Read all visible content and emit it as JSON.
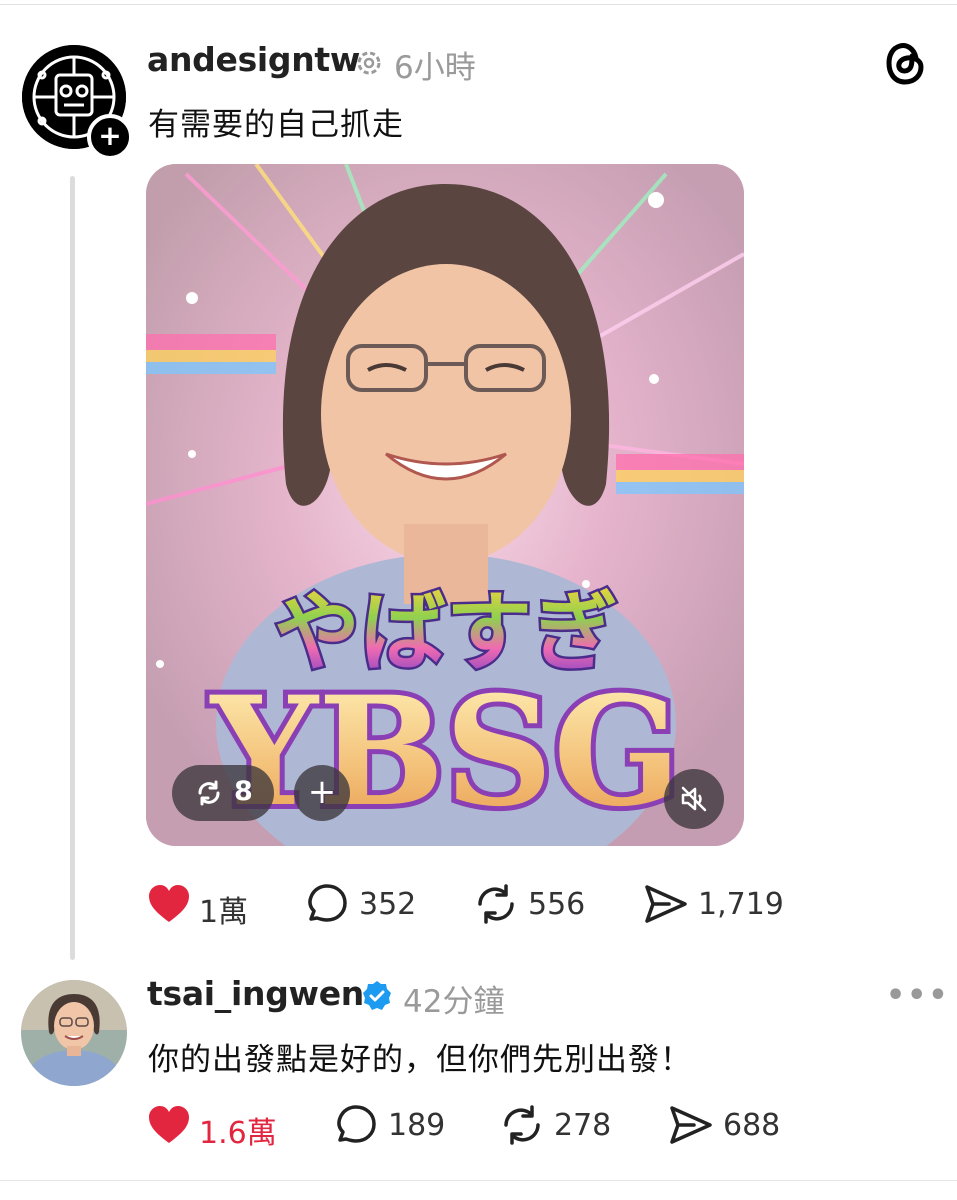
{
  "post": {
    "username": "andesigntw",
    "time": "6小時",
    "text": "有需要的自己抓走",
    "media": {
      "jp_text": "やばすぎ",
      "big_text": "YBSG",
      "repost_count": "8"
    },
    "actions": {
      "likes": "1萬",
      "replies": "352",
      "reposts": "556",
      "shares": "1,719"
    }
  },
  "reply": {
    "username": "tsai_ingwen",
    "time": "42分鐘",
    "text": "你的出發點是好的，但你們先別出發！",
    "actions": {
      "likes": "1.6萬",
      "replies": "189",
      "reposts": "278",
      "shares": "688"
    }
  },
  "colors": {
    "like_red": "#e3263f",
    "verified_blue": "#1d9bf0",
    "muted_gray": "#9a9a9a"
  },
  "icons": [
    "follow-plus-icon",
    "threads-logo-icon",
    "heart-icon",
    "comment-icon",
    "repost-icon",
    "share-icon",
    "mute-icon",
    "verified-badge-icon",
    "more-icon"
  ]
}
